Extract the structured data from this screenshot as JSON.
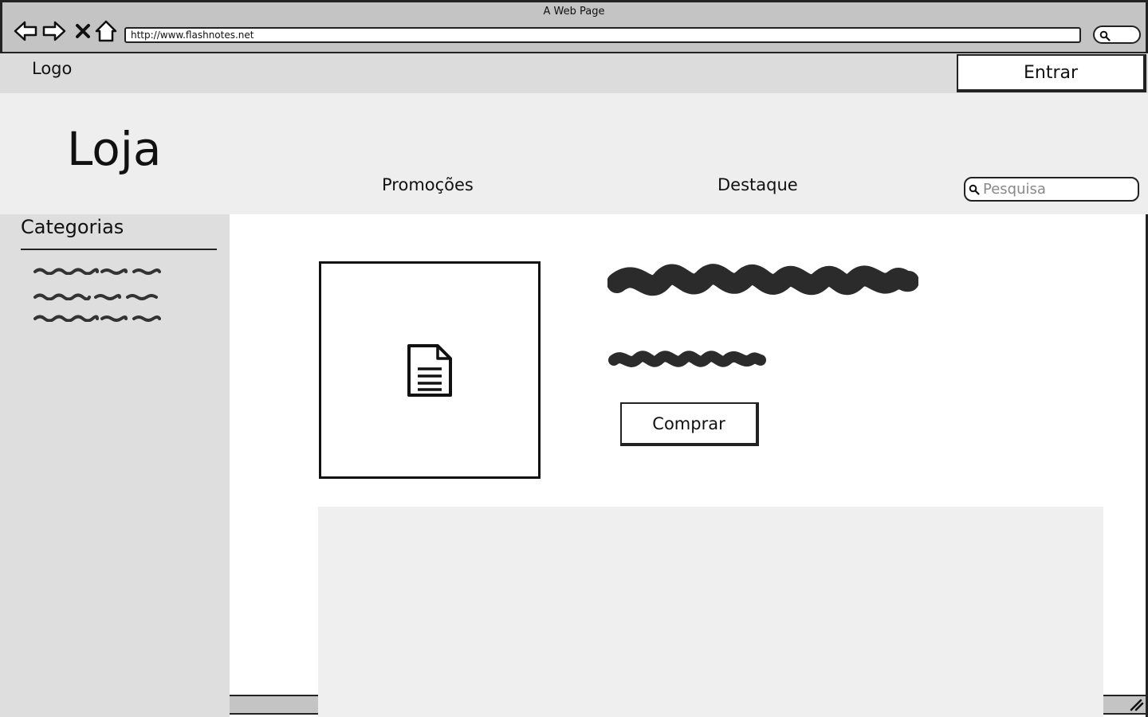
{
  "browser": {
    "window_title": "A Web Page",
    "url": "http://www.flashnotes.net"
  },
  "header": {
    "logo": "Logo",
    "login_label": "Entrar"
  },
  "store": {
    "title": "Loja",
    "nav": [
      "Promoções",
      "Destaque"
    ],
    "search_placeholder": "Pesquisa"
  },
  "sidebar": {
    "heading": "Categorias",
    "item_count": 3
  },
  "product": {
    "image_icon": "document-icon",
    "buy_label": "Comprar"
  },
  "colors": {
    "chrome": "#c4c4c4",
    "header": "#dcdcdc",
    "store_band": "#eeeeee",
    "sidebar": "#dedede",
    "panel": "#efefef",
    "ink": "#222222"
  }
}
